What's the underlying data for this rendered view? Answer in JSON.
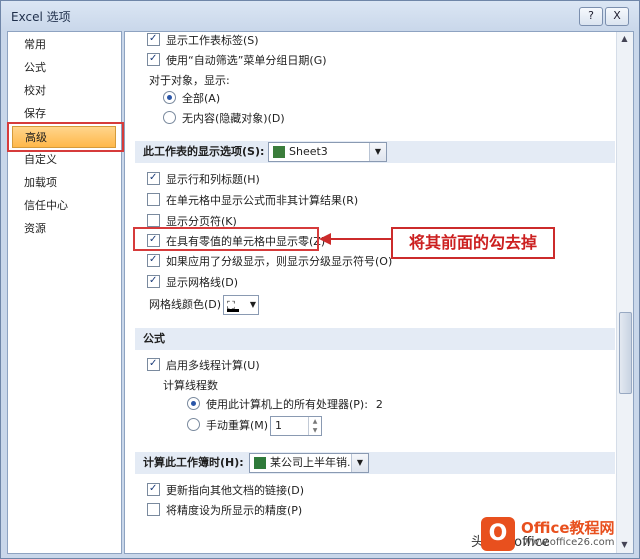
{
  "window": {
    "title": "Excel 选项",
    "help": "?",
    "close": "X"
  },
  "sidebar": {
    "items": [
      {
        "label": "常用"
      },
      {
        "label": "公式"
      },
      {
        "label": "校对"
      },
      {
        "label": "保存"
      },
      {
        "label": "高级"
      },
      {
        "label": "自定义"
      },
      {
        "label": "加载项"
      },
      {
        "label": "信任中心"
      },
      {
        "label": "资源"
      }
    ],
    "selected": "高级"
  },
  "group_top": {
    "cb1": "显示工作表标签(S)",
    "cb2": "使用“自动筛选”菜单分组日期(G)",
    "objects_label": "对于对象，显示:",
    "radio_all": "全部(A)",
    "radio_none": "无内容(隐藏对象)(D)"
  },
  "sheet_section": {
    "title": "此工作表的显示选项(S):",
    "sheet": "Sheet3",
    "items": [
      {
        "label": "显示行和列标题(H)",
        "checked": true
      },
      {
        "label": "在单元格中显示公式而非其计算结果(R)",
        "checked": false
      },
      {
        "label": "显示分页符(K)",
        "checked": false
      },
      {
        "label": "在具有零值的单元格中显示零(Z)",
        "checked": true
      },
      {
        "label": "如果应用了分级显示，则显示分级显示符号(O)",
        "checked": true
      },
      {
        "label": "显示网格线(D)",
        "checked": true
      }
    ],
    "gridcolor_label": "网格线颜色(D)"
  },
  "formula_section": {
    "title": "公式",
    "multithread": "启用多线程计算(U)",
    "threads_label": "计算线程数",
    "all_proc": "使用此计算机上的所有处理器(P):",
    "proc_count": "2",
    "manual": "手动重算(M)",
    "manual_value": "1"
  },
  "workbook_section": {
    "title": "计算此工作簿时(H):",
    "workbook": "某公司上半年销...",
    "update_links": "更新指向其他文档的链接(D)",
    "precision": "将精度设为所显示的精度(P)"
  },
  "annotation": {
    "text": "将其前面的勾去掉"
  },
  "watermark": {
    "brand": "Office教程网",
    "site": "www.office26.com",
    "toutiao": "头条 @office"
  }
}
